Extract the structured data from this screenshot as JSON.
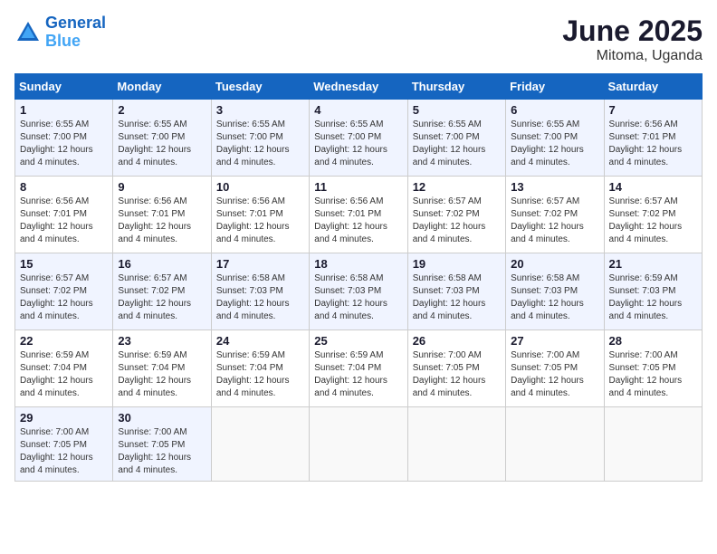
{
  "header": {
    "logo_line1": "General",
    "logo_line2": "Blue",
    "month": "June 2025",
    "location": "Mitoma, Uganda"
  },
  "days_of_week": [
    "Sunday",
    "Monday",
    "Tuesday",
    "Wednesday",
    "Thursday",
    "Friday",
    "Saturday"
  ],
  "weeks": [
    [
      {
        "day": "1",
        "sunrise": "6:55 AM",
        "sunset": "7:00 PM",
        "daylight": "12 hours and 4 minutes."
      },
      {
        "day": "2",
        "sunrise": "6:55 AM",
        "sunset": "7:00 PM",
        "daylight": "12 hours and 4 minutes."
      },
      {
        "day": "3",
        "sunrise": "6:55 AM",
        "sunset": "7:00 PM",
        "daylight": "12 hours and 4 minutes."
      },
      {
        "day": "4",
        "sunrise": "6:55 AM",
        "sunset": "7:00 PM",
        "daylight": "12 hours and 4 minutes."
      },
      {
        "day": "5",
        "sunrise": "6:55 AM",
        "sunset": "7:00 PM",
        "daylight": "12 hours and 4 minutes."
      },
      {
        "day": "6",
        "sunrise": "6:55 AM",
        "sunset": "7:00 PM",
        "daylight": "12 hours and 4 minutes."
      },
      {
        "day": "7",
        "sunrise": "6:56 AM",
        "sunset": "7:01 PM",
        "daylight": "12 hours and 4 minutes."
      }
    ],
    [
      {
        "day": "8",
        "sunrise": "6:56 AM",
        "sunset": "7:01 PM",
        "daylight": "12 hours and 4 minutes."
      },
      {
        "day": "9",
        "sunrise": "6:56 AM",
        "sunset": "7:01 PM",
        "daylight": "12 hours and 4 minutes."
      },
      {
        "day": "10",
        "sunrise": "6:56 AM",
        "sunset": "7:01 PM",
        "daylight": "12 hours and 4 minutes."
      },
      {
        "day": "11",
        "sunrise": "6:56 AM",
        "sunset": "7:01 PM",
        "daylight": "12 hours and 4 minutes."
      },
      {
        "day": "12",
        "sunrise": "6:57 AM",
        "sunset": "7:02 PM",
        "daylight": "12 hours and 4 minutes."
      },
      {
        "day": "13",
        "sunrise": "6:57 AM",
        "sunset": "7:02 PM",
        "daylight": "12 hours and 4 minutes."
      },
      {
        "day": "14",
        "sunrise": "6:57 AM",
        "sunset": "7:02 PM",
        "daylight": "12 hours and 4 minutes."
      }
    ],
    [
      {
        "day": "15",
        "sunrise": "6:57 AM",
        "sunset": "7:02 PM",
        "daylight": "12 hours and 4 minutes."
      },
      {
        "day": "16",
        "sunrise": "6:57 AM",
        "sunset": "7:02 PM",
        "daylight": "12 hours and 4 minutes."
      },
      {
        "day": "17",
        "sunrise": "6:58 AM",
        "sunset": "7:03 PM",
        "daylight": "12 hours and 4 minutes."
      },
      {
        "day": "18",
        "sunrise": "6:58 AM",
        "sunset": "7:03 PM",
        "daylight": "12 hours and 4 minutes."
      },
      {
        "day": "19",
        "sunrise": "6:58 AM",
        "sunset": "7:03 PM",
        "daylight": "12 hours and 4 minutes."
      },
      {
        "day": "20",
        "sunrise": "6:58 AM",
        "sunset": "7:03 PM",
        "daylight": "12 hours and 4 minutes."
      },
      {
        "day": "21",
        "sunrise": "6:59 AM",
        "sunset": "7:03 PM",
        "daylight": "12 hours and 4 minutes."
      }
    ],
    [
      {
        "day": "22",
        "sunrise": "6:59 AM",
        "sunset": "7:04 PM",
        "daylight": "12 hours and 4 minutes."
      },
      {
        "day": "23",
        "sunrise": "6:59 AM",
        "sunset": "7:04 PM",
        "daylight": "12 hours and 4 minutes."
      },
      {
        "day": "24",
        "sunrise": "6:59 AM",
        "sunset": "7:04 PM",
        "daylight": "12 hours and 4 minutes."
      },
      {
        "day": "25",
        "sunrise": "6:59 AM",
        "sunset": "7:04 PM",
        "daylight": "12 hours and 4 minutes."
      },
      {
        "day": "26",
        "sunrise": "7:00 AM",
        "sunset": "7:05 PM",
        "daylight": "12 hours and 4 minutes."
      },
      {
        "day": "27",
        "sunrise": "7:00 AM",
        "sunset": "7:05 PM",
        "daylight": "12 hours and 4 minutes."
      },
      {
        "day": "28",
        "sunrise": "7:00 AM",
        "sunset": "7:05 PM",
        "daylight": "12 hours and 4 minutes."
      }
    ],
    [
      {
        "day": "29",
        "sunrise": "7:00 AM",
        "sunset": "7:05 PM",
        "daylight": "12 hours and 4 minutes."
      },
      {
        "day": "30",
        "sunrise": "7:00 AM",
        "sunset": "7:05 PM",
        "daylight": "12 hours and 4 minutes."
      },
      null,
      null,
      null,
      null,
      null
    ]
  ],
  "labels": {
    "sunrise": "Sunrise:",
    "sunset": "Sunset:",
    "daylight": "Daylight:"
  }
}
